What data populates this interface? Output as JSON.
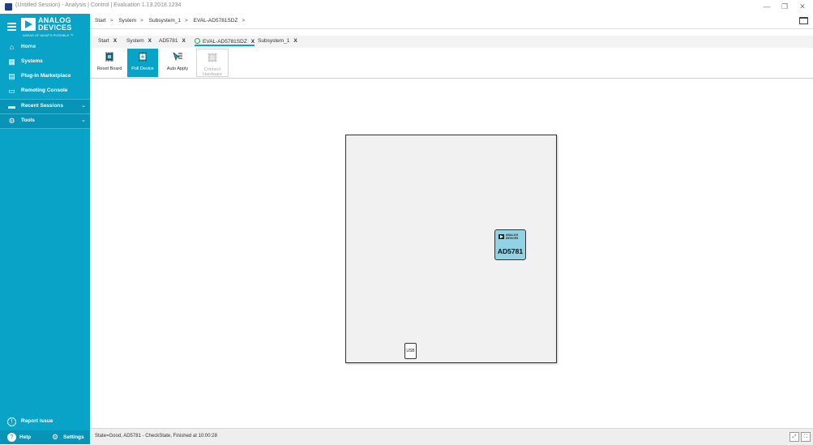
{
  "window": {
    "title": "(Untitled Session) - Analysis | Control | Evaluation 1.13.2018.1234",
    "minimize_glyph": "—",
    "restore_glyph": "❐",
    "close_glyph": "✕"
  },
  "sidebar": {
    "logo": {
      "line1": "ANALOG",
      "line2": "DEVICES",
      "tagline": "AHEAD OF WHAT'S POSSIBLE ™"
    },
    "items": [
      {
        "label": "Home",
        "icon": "home-icon",
        "glyph": "⌂"
      },
      {
        "label": "Systems",
        "icon": "systems-icon",
        "glyph": "▦"
      },
      {
        "label": "Plug-in Marketplace",
        "icon": "marketplace-icon",
        "glyph": "▤"
      },
      {
        "label": "Remoting Console",
        "icon": "console-icon",
        "glyph": "▭"
      },
      {
        "label": "Recent Sessions",
        "icon": "folder-icon",
        "glyph": "▬"
      },
      {
        "label": "Tools",
        "icon": "tools-icon",
        "glyph": "⚙"
      }
    ],
    "chevron_glyph": "⌄",
    "report_issue": "Report Issue",
    "help": "Help",
    "settings": "Settings"
  },
  "breadcrumb": {
    "items": [
      "Start",
      "System",
      "Subsystem_1",
      "EVAL-AD5781SDZ"
    ],
    "separator": ">"
  },
  "tabs": [
    {
      "label": "Start",
      "active": false,
      "status": false
    },
    {
      "label": "System",
      "active": false,
      "status": false
    },
    {
      "label": "AD5781",
      "active": false,
      "status": false
    },
    {
      "label": "EVAL-AD5781SDZ",
      "active": true,
      "status": true
    },
    {
      "label": "Subsystem_1",
      "active": false,
      "status": false
    }
  ],
  "tab_close_glyph": "X",
  "toolbar": {
    "reset_board": "Reset Board",
    "poll_device": "Poll Device",
    "auto_apply": "Auto Apply",
    "connect_hardware": "Connect Hardware"
  },
  "canvas": {
    "chip_brand_line1": "ANALOG",
    "chip_brand_line2": "DEVICES",
    "chip_part": "AD5781",
    "usb_label": "USB"
  },
  "status": {
    "text": "State=Good, AD5781 - CheckState, Finished at 10:00:28"
  },
  "colors": {
    "accent": "#0aa3c8",
    "chip": "#8fd3e4",
    "board": "#f1f1f1"
  }
}
